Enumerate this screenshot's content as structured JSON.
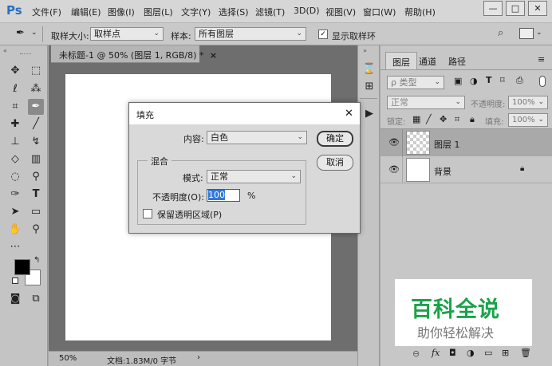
{
  "app": {
    "logo": "Ps",
    "menu": [
      "文件(F)",
      "编辑(E)",
      "图像(I)",
      "图层(L)",
      "文字(Y)",
      "选择(S)",
      "滤镜(T)",
      "3D(D)",
      "视图(V)",
      "窗口(W)",
      "帮助(H)"
    ],
    "window_buttons": [
      "—",
      "□",
      "✕"
    ]
  },
  "options_bar": {
    "sample_size_label": "取样大小:",
    "sample_size_value": "取样点",
    "sample_label": "样本:",
    "sample_value": "所有图层",
    "show_ring_label": "显示取样环",
    "show_ring_checked": true
  },
  "document": {
    "tab_title": "未标题-1 @ 50% (图层 1, RGB/8) *",
    "tab_close": "×",
    "zoom": "50%",
    "doc_info": "文档:1.83M/0 字节",
    "status_arrow": "›"
  },
  "layers_panel": {
    "tabs": [
      "图层",
      "通道",
      "路径"
    ],
    "kind_filter": "ρ 类型",
    "blend_mode": "正常",
    "opacity_label": "不透明度:",
    "opacity_value": "100%",
    "lock_label": "锁定:",
    "fill_label": "填充:",
    "fill_value": "100%",
    "layers": [
      {
        "name": "图层 1",
        "visible": true,
        "transparent": true,
        "selected": true
      },
      {
        "name": "背景",
        "visible": true,
        "transparent": false,
        "locked": true
      }
    ]
  },
  "watermark": {
    "title": "百科全说",
    "subtitle": "助你轻松解决",
    "title_color": "#1aa34a"
  },
  "fill_dialog": {
    "title": "填充",
    "close": "✕",
    "content_label": "内容:",
    "content_value": "白色",
    "ok_label": "确定",
    "cancel_label": "取消",
    "blend_group_label": "混合",
    "mode_label": "模式:",
    "mode_value": "正常",
    "opacity_label": "不透明度(O):",
    "opacity_value": "100",
    "opacity_unit": "%",
    "preserve_transparency_label": "保留透明区域(P)",
    "preserve_transparency_checked": false
  },
  "colors": {
    "foreground": "#000000",
    "background": "#ffffff"
  }
}
